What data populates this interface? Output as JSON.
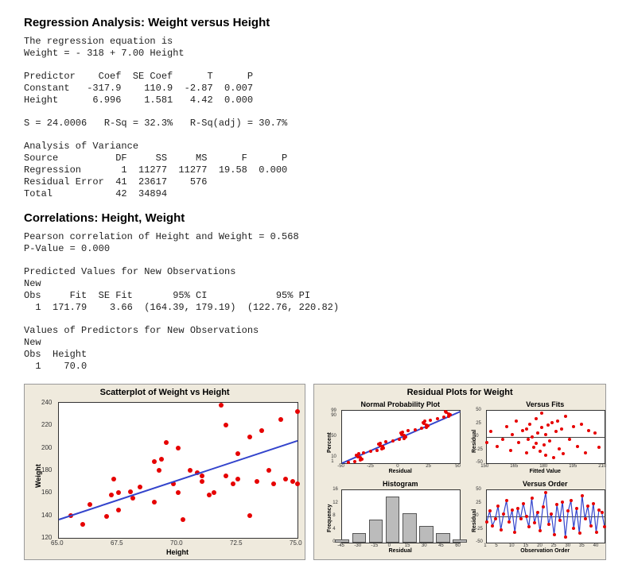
{
  "heading1": "Regression Analysis: Weight versus Height",
  "equation_text": "The regression equation is\nWeight = - 318 + 7.00 Height",
  "coef_table": "Predictor    Coef  SE Coef      T      P\nConstant   -317.9    110.9  -2.87  0.007\nHeight      6.996    1.581   4.42  0.000",
  "summary_stats": "S = 24.0006   R-Sq = 32.3%   R-Sq(adj) = 30.7%",
  "anova_table": "Analysis of Variance\nSource          DF     SS     MS      F      P\nRegression       1  11277  11277  19.58  0.000\nResidual Error  41  23617    576\nTotal           42  34894",
  "heading2": "Correlations: Height, Weight",
  "correlation_text": "Pearson correlation of Height and Weight = 0.568\nP-Value = 0.000",
  "newobs_table": "Predicted Values for New Observations\nNew\nObs     Fit  SE Fit       95% CI            95% PI\n  1  171.79    3.66  (164.39, 179.19)  (122.76, 220.82)",
  "predictors_table": "Values of Predictors for New Observations\nNew\nObs  Height\n  1    70.0",
  "scatterplot_title": "Scatterplot of Weight vs Height",
  "scatterplot_xlabel": "Height",
  "scatterplot_ylabel": "Weight",
  "residuals_title": "Residual Plots for Weight",
  "normplot_title": "Normal Probability Plot",
  "normplot_xlabel": "Residual",
  "normplot_ylabel": "Percent",
  "vfits_title": "Versus Fits",
  "vfits_xlabel": "Fitted Value",
  "vfits_ylabel": "Residual",
  "hist_title": "Histogram",
  "hist_xlabel": "Residual",
  "hist_ylabel": "Frequency",
  "vorder_title": "Versus Order",
  "vorder_xlabel": "Observation Order",
  "vorder_ylabel": "Residual",
  "chart_data": [
    {
      "type": "scatter",
      "title": "Scatterplot of Weight vs Height",
      "xlabel": "Height",
      "ylabel": "Weight",
      "xlim": [
        65.0,
        75.0
      ],
      "ylim": [
        120,
        240
      ],
      "xticks": [
        65.0,
        67.5,
        70.0,
        72.5,
        75.0
      ],
      "yticks": [
        120,
        140,
        160,
        180,
        200,
        220,
        240
      ],
      "series": [
        {
          "name": "Observed",
          "x": [
            65.5,
            66.0,
            66.3,
            67.0,
            67.2,
            67.3,
            67.5,
            67.5,
            68.0,
            68.1,
            68.4,
            69.0,
            69.0,
            69.2,
            69.3,
            69.5,
            69.8,
            70.0,
            70.0,
            70.2,
            70.5,
            70.8,
            71.0,
            71.0,
            71.3,
            71.5,
            71.8,
            72.0,
            72.0,
            72.3,
            72.5,
            72.5,
            73.0,
            73.0,
            73.3,
            73.5,
            73.8,
            74.0,
            74.3,
            74.5,
            74.8,
            75.0,
            75.0
          ],
          "y": [
            140,
            132,
            150,
            139,
            158,
            172,
            145,
            160,
            161,
            155,
            165,
            152,
            188,
            180,
            190,
            205,
            168,
            160,
            200,
            136,
            180,
            178,
            175,
            170,
            158,
            160,
            238,
            175,
            220,
            168,
            172,
            195,
            210,
            140,
            170,
            215,
            180,
            168,
            225,
            172,
            170,
            168,
            232
          ]
        },
        {
          "name": "Fit",
          "x": [
            65,
            75
          ],
          "y": [
            137,
            207
          ]
        }
      ]
    },
    {
      "type": "scatter",
      "title": "Normal Probability Plot",
      "xlabel": "Residual",
      "ylabel": "Percent",
      "xlim": [
        -50,
        50
      ],
      "xticks": [
        -50,
        -25,
        0,
        25,
        50
      ],
      "yticks": [
        1,
        10,
        50,
        90,
        99
      ]
    },
    {
      "type": "scatter",
      "title": "Versus Fits",
      "xlabel": "Fitted Value",
      "ylabel": "Residual",
      "xlim": [
        150,
        210
      ],
      "ylim": [
        -50,
        50
      ],
      "xticks": [
        150,
        165,
        180,
        195,
        210
      ],
      "yticks": [
        -50,
        -25,
        0,
        25,
        50
      ]
    },
    {
      "type": "bar",
      "title": "Histogram",
      "xlabel": "Residual",
      "ylabel": "Frequency",
      "xlim": [
        -45,
        60
      ],
      "ylim": [
        0,
        16
      ],
      "xticks": [
        -45,
        -30,
        -15,
        0,
        15,
        30,
        45,
        60
      ],
      "yticks": [
        0,
        4,
        8,
        12,
        16
      ],
      "categories": [
        -45,
        -30,
        -15,
        0,
        15,
        30,
        45,
        60
      ],
      "values": [
        1,
        3,
        7,
        14,
        9,
        5,
        3,
        1
      ]
    },
    {
      "type": "line",
      "title": "Versus Order",
      "xlabel": "Observation Order",
      "ylabel": "Residual",
      "xlim": [
        1,
        43
      ],
      "ylim": [
        -50,
        50
      ],
      "xticks": [
        1,
        5,
        10,
        15,
        20,
        25,
        30,
        35,
        40
      ],
      "yticks": [
        -50,
        -25,
        0,
        25,
        50
      ]
    }
  ]
}
